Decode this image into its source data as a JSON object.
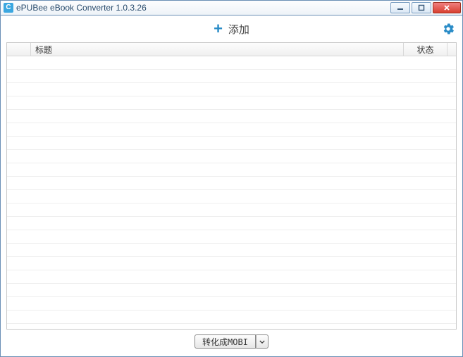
{
  "window": {
    "title": "ePUBee eBook Converter 1.0.3.26"
  },
  "toolbar": {
    "add_label": "添加"
  },
  "table": {
    "headers": {
      "title": "标题",
      "status": "状态"
    },
    "rows": []
  },
  "footer": {
    "convert_label": "转化成MOBI"
  }
}
